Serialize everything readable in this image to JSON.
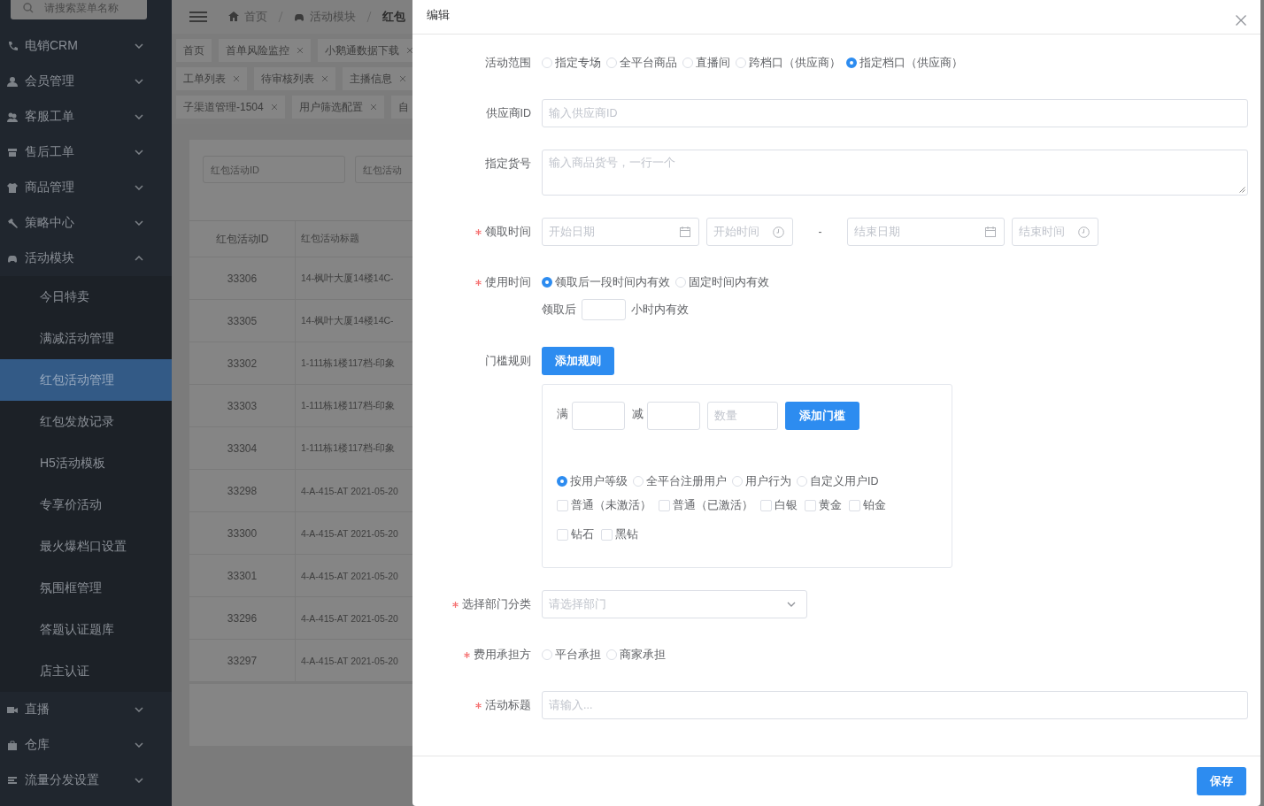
{
  "sidebar": {
    "search_placeholder": "请搜索菜单名称",
    "menu": [
      {
        "label": "电销CRM",
        "expanded": false
      },
      {
        "label": "会员管理",
        "expanded": false
      },
      {
        "label": "客服工单",
        "expanded": false
      },
      {
        "label": "售后工单",
        "expanded": false
      },
      {
        "label": "商品管理",
        "expanded": false
      },
      {
        "label": "策略中心",
        "expanded": false
      },
      {
        "label": "活动模块",
        "expanded": true,
        "children": [
          {
            "label": "今日特卖",
            "selected": false
          },
          {
            "label": "满减活动管理",
            "selected": false
          },
          {
            "label": "红包活动管理",
            "selected": true
          },
          {
            "label": "红包发放记录",
            "selected": false
          },
          {
            "label": "H5活动模板",
            "selected": false
          },
          {
            "label": "专享价活动",
            "selected": false
          },
          {
            "label": "最火爆档口设置",
            "selected": false
          },
          {
            "label": "氛围框管理",
            "selected": false
          },
          {
            "label": "答题认证题库",
            "selected": false
          },
          {
            "label": "店主认证",
            "selected": false
          }
        ]
      },
      {
        "label": "直播",
        "expanded": false
      },
      {
        "label": "仓库",
        "expanded": false
      },
      {
        "label": "流量分发设置",
        "expanded": false
      }
    ]
  },
  "header": {
    "breadcrumb": [
      "首页",
      "活动模块",
      "红包"
    ]
  },
  "tag_rows": [
    [
      {
        "label": "首页",
        "closable": false
      },
      {
        "label": "首单风险监控",
        "closable": true
      },
      {
        "label": "小鹅通数据下载",
        "closable": true
      }
    ],
    [
      {
        "label": "工单列表",
        "closable": true
      },
      {
        "label": "待审核列表",
        "closable": true
      },
      {
        "label": "主播信息",
        "closable": true
      }
    ],
    [
      {
        "label": "子渠道管理-1504",
        "closable": true
      },
      {
        "label": "用户筛选配置",
        "closable": true
      },
      {
        "label": "自",
        "closable": false
      }
    ]
  ],
  "filters": [
    {
      "placeholder": "红包活动ID"
    },
    {
      "placeholder": "红包活动"
    }
  ],
  "table": {
    "columns": [
      "红包活动ID",
      "红包活动标题"
    ],
    "rows": [
      [
        "33306",
        "14-枫叶大厦14楼14C-"
      ],
      [
        "33305",
        "14-枫叶大厦14楼14C-"
      ],
      [
        "33302",
        "1-111栋1楼117档-印象"
      ],
      [
        "33303",
        "1-111栋1楼117档-印象"
      ],
      [
        "33304",
        "1-111栋1楼117档-印象"
      ],
      [
        "33298",
        "4-A-415-AT 2021-05-20"
      ],
      [
        "33300",
        "4-A-415-AT 2021-05-20"
      ],
      [
        "33301",
        "4-A-415-AT 2021-05-20"
      ],
      [
        "33296",
        "4-A-415-AT 2021-05-20"
      ],
      [
        "33297",
        "4-A-415-AT 2021-05-20"
      ]
    ]
  },
  "dialog": {
    "title": "编辑",
    "fields": [
      {
        "kind": "radio",
        "label": "活动范围",
        "required": false,
        "options": [
          {
            "label": "指定专场",
            "selected": false
          },
          {
            "label": "全平台商品",
            "selected": false
          },
          {
            "label": "直播间",
            "selected": false
          },
          {
            "label": "跨档口（供应商）",
            "selected": false
          },
          {
            "label": "指定档口（供应商）",
            "selected": true
          }
        ]
      },
      {
        "kind": "input",
        "label": "供应商ID",
        "required": false,
        "placeholder": "输入供应商ID"
      },
      {
        "kind": "textarea",
        "label": "指定货号",
        "required": false,
        "placeholder": "输入商品货号，一行一个"
      },
      {
        "kind": "datetime",
        "label": "领取时间",
        "required": true,
        "start_date": "开始日期",
        "start_time": "开始时间",
        "separator": "-",
        "end_date": "结束日期",
        "end_time": "结束时间"
      },
      {
        "kind": "usage",
        "label": "使用时间",
        "required": true,
        "options": [
          {
            "label": "领取后一段时间内有效",
            "selected": true
          },
          {
            "label": "固定时间内有效",
            "selected": false
          }
        ],
        "prefix": "领取后",
        "suffix": "小时内有效"
      },
      {
        "kind": "rules",
        "label": "门槛规则",
        "required": false,
        "button": "添加规则",
        "full": "满",
        "minus": "减",
        "quantity_placeholder": "数量",
        "threshold_button": "添加门槛",
        "audience": [
          {
            "label": "按用户等级",
            "selected": true
          },
          {
            "label": "全平台注册用户",
            "selected": false
          },
          {
            "label": "用户行为",
            "selected": false
          },
          {
            "label": "自定义用户ID",
            "selected": false
          }
        ],
        "levels": [
          {
            "label": "普通（未激活）",
            "checked": false
          },
          {
            "label": "普通（已激活）",
            "checked": false
          },
          {
            "label": "白银",
            "checked": false
          },
          {
            "label": "黄金",
            "checked": false
          },
          {
            "label": "铂金",
            "checked": false
          },
          {
            "label": "钻石",
            "checked": false
          },
          {
            "label": "黑钻",
            "checked": false
          }
        ]
      },
      {
        "kind": "select",
        "label": "选择部门分类",
        "required": true,
        "placeholder": "请选择部门"
      },
      {
        "kind": "radio",
        "label": "费用承担方",
        "required": true,
        "options": [
          {
            "label": "平台承担",
            "selected": false
          },
          {
            "label": "商家承担",
            "selected": false
          }
        ]
      },
      {
        "kind": "input",
        "label": "活动标题",
        "required": true,
        "placeholder": "请输入..."
      }
    ],
    "save_button": "保存"
  }
}
